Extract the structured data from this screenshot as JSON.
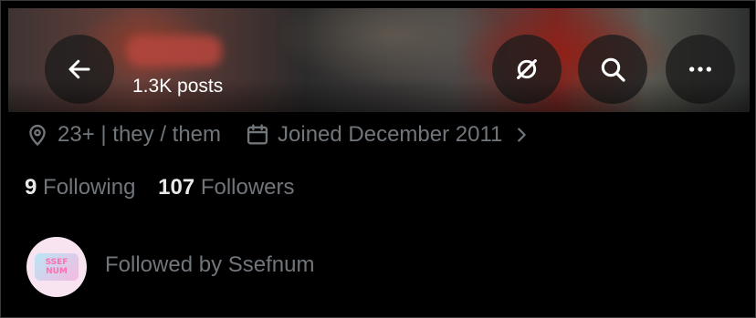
{
  "header": {
    "posts_count": "1.3K posts",
    "icons": [
      "back-arrow-icon",
      "grok-icon",
      "search-icon",
      "more-icon"
    ]
  },
  "profile": {
    "location": "23+ | they / them",
    "joined": "Joined December 2011",
    "following_count": "9",
    "following_label": "Following",
    "followers_count": "107",
    "followers_label": "Followers",
    "followed_by": "Followed by Ssefnum",
    "avatar_text": [
      "SSEF",
      "NUM"
    ]
  },
  "colors": {
    "background": "#000000",
    "muted_text": "#71767b",
    "primary_text": "#e7e9ea"
  }
}
